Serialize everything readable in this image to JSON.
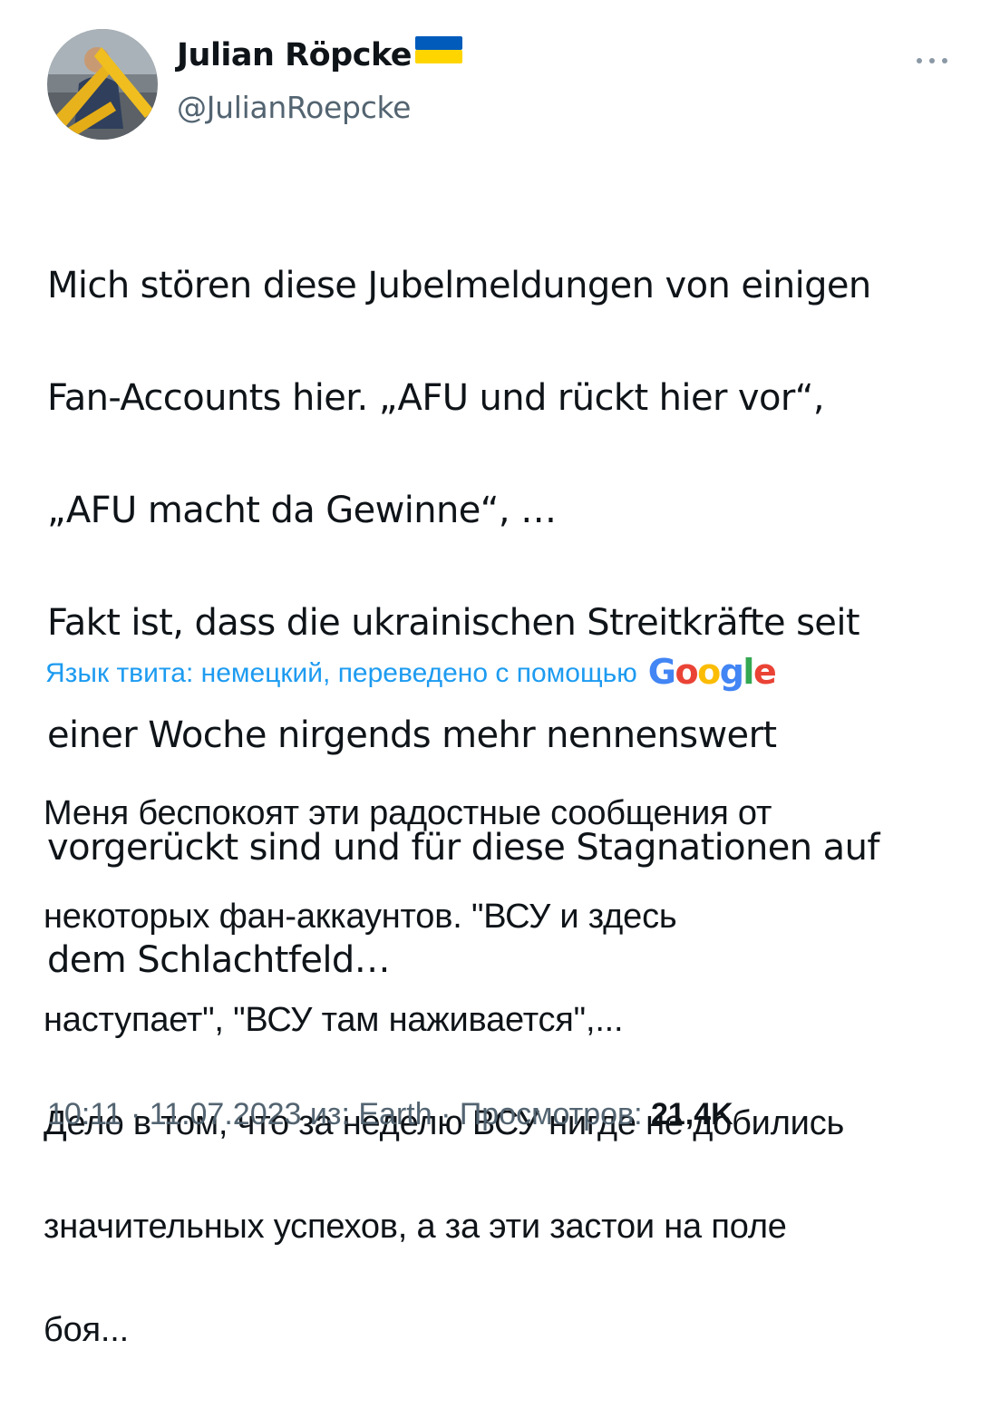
{
  "author": {
    "display_name": "Julian Röpcke",
    "handle": "@JulianRoepcke",
    "flag_icon": "ukraine-flag-icon",
    "flag_colors": [
      "#005bbb",
      "#ffd500"
    ]
  },
  "tweet": {
    "original_lines": [
      "Mich stören diese Jubelmeldungen von einigen",
      "Fan-Accounts hier. „AFU und rückt hier vor“,",
      "„AFU macht da Gewinne“, …",
      "Fakt ist, dass die ukrainischen Streitkräfte seit",
      "einer Woche nirgends mehr nennenswert",
      "vorgerückt sind und für diese  Stagnationen auf",
      "dem Schlachtfeld…"
    ],
    "translation_label": "Язык твита: немецкий, переведено с помощью",
    "translation_provider": "Google",
    "translated_lines": [
      "Меня беспокоят эти радостные сообщения от",
      "некоторых фан-аккаунтов. \"ВСУ и здесь",
      "наступает\", \"ВСУ там наживается\",...",
      "Дело в том, что за неделю ВСУ нигде не добились",
      "значительных успехов, а за эти застои на поле",
      "боя..."
    ]
  },
  "meta": {
    "time": "10:11",
    "separator": " · ",
    "date": "11.07.2023",
    "source_prefix": " из: ",
    "source": "Earth",
    "views_label": "Просмотров: ",
    "views_count": "21,4K"
  },
  "colors": {
    "text": "#0f1419",
    "secondary": "#536471",
    "link": "#1d9bf0",
    "google": [
      "#4285F4",
      "#EA4335",
      "#FBBC05",
      "#4285F4",
      "#34A853",
      "#EA4335"
    ]
  }
}
